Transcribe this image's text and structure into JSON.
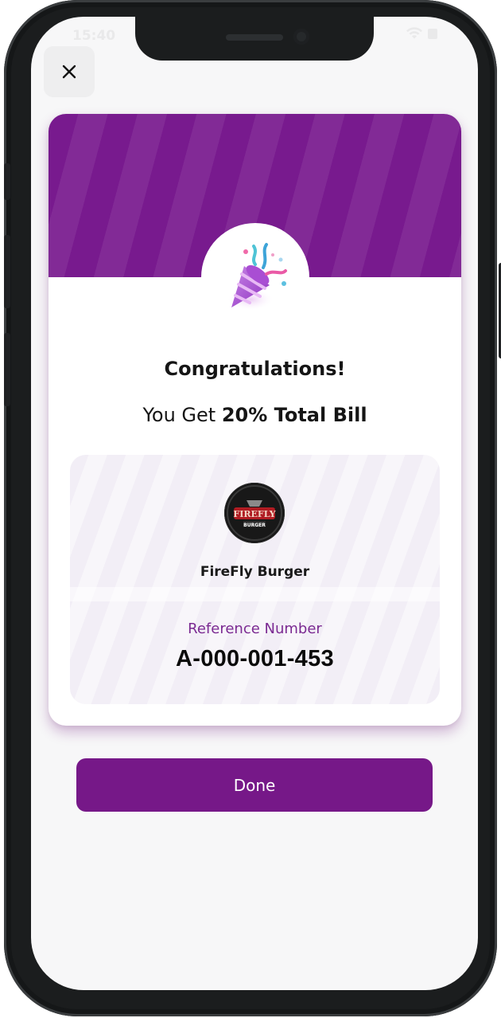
{
  "status_bar": {
    "time": "15:40",
    "icons": "wifi-icon battery-icon"
  },
  "close": {
    "icon": "close-icon"
  },
  "celebration": {
    "icon": "party-popper-icon",
    "title": "Congratulations!",
    "reward_prefix": "You Get",
    "reward_value": "20% Total Bill"
  },
  "merchant": {
    "logo_text_top": "FIREFLY",
    "logo_text_bottom": "BURGER",
    "name": "FireFly Burger",
    "reference_label": "Reference Number",
    "reference_number": "A-000-001-453"
  },
  "actions": {
    "done_label": "Done"
  },
  "colors": {
    "brand": "#781a8e",
    "button": "#761888",
    "reference_label": "#7b2a92"
  }
}
